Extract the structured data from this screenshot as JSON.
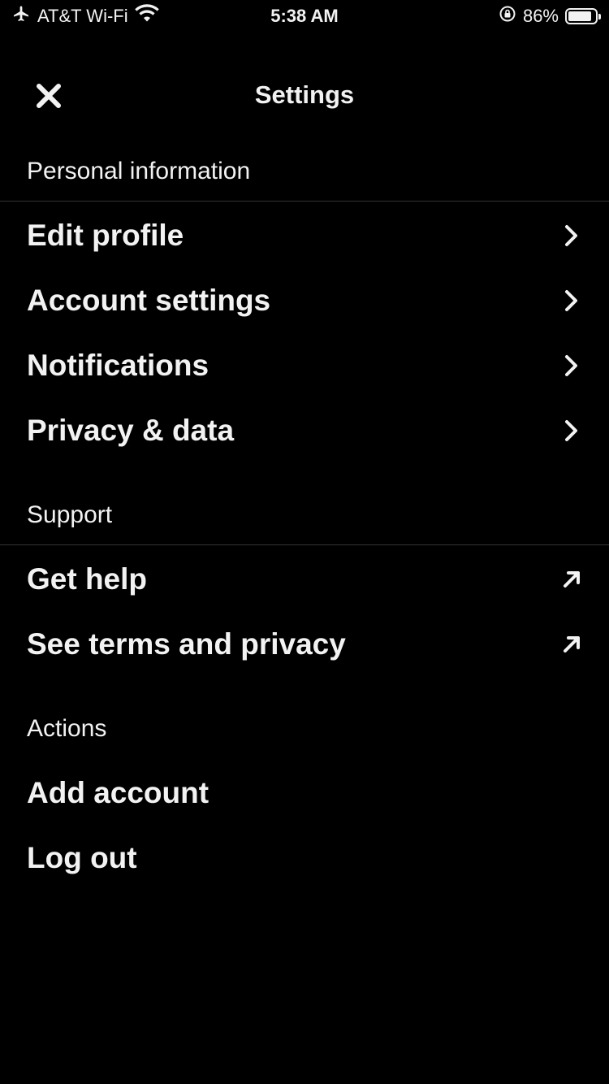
{
  "status_bar": {
    "carrier": "AT&T Wi-Fi",
    "time": "5:38 AM",
    "battery_percent": "86%",
    "battery_level": 0.86,
    "icons": [
      "airplane-icon",
      "wifi-icon",
      "orientation-lock-icon",
      "battery-icon"
    ]
  },
  "header": {
    "title": "Settings",
    "close_icon": "close-icon"
  },
  "sections": {
    "personal": {
      "title": "Personal information",
      "items": [
        {
          "label": "Edit profile",
          "icon": "chevron-right-icon"
        },
        {
          "label": "Account settings",
          "icon": "chevron-right-icon"
        },
        {
          "label": "Notifications",
          "icon": "chevron-right-icon"
        },
        {
          "label": "Privacy & data",
          "icon": "chevron-right-icon"
        }
      ]
    },
    "support": {
      "title": "Support",
      "items": [
        {
          "label": "Get help",
          "icon": "external-link-arrow-icon"
        },
        {
          "label": "See terms and privacy",
          "icon": "external-link-arrow-icon"
        }
      ]
    },
    "actions": {
      "title": "Actions",
      "items": [
        {
          "label": "Add account"
        },
        {
          "label": "Log out"
        }
      ]
    }
  },
  "colors": {
    "background": "#000000",
    "text": "#f2f2f2",
    "divider": "#333333"
  }
}
